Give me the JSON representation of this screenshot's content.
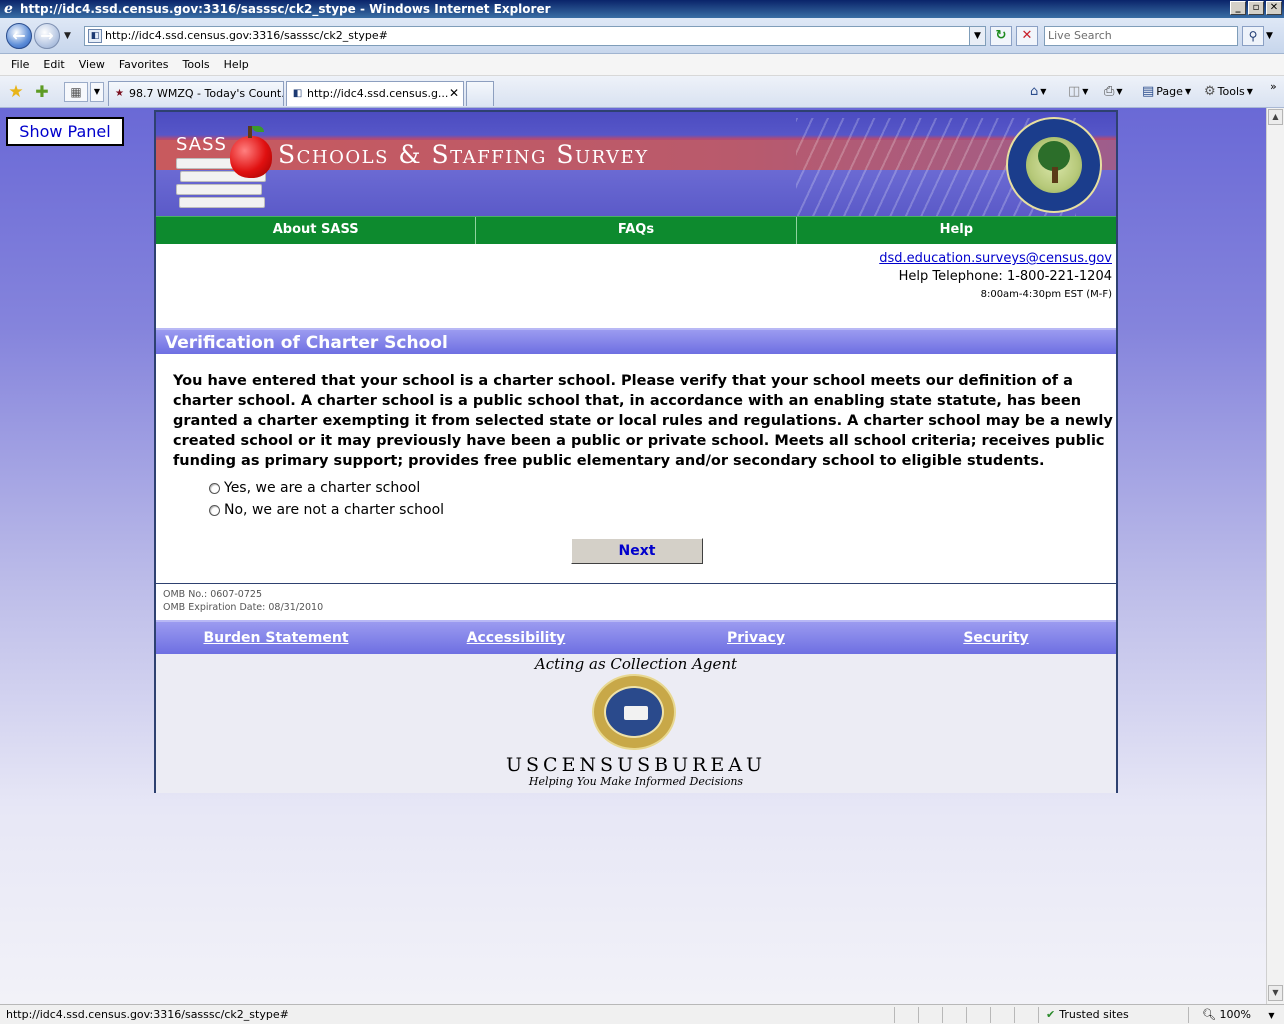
{
  "window": {
    "title": "http://idc4.ssd.census.gov:3316/sasssc/ck2_stype - Windows Internet Explorer",
    "buttons": [
      "_",
      "▫",
      "✕"
    ]
  },
  "address": {
    "url": "http://idc4.ssd.census.gov:3316/sasssc/ck2_stype#",
    "search_placeholder": "Live Search"
  },
  "menu": [
    "File",
    "Edit",
    "View",
    "Favorites",
    "Tools",
    "Help"
  ],
  "tabs": [
    {
      "label": "98.7 WMZQ - Today's Count..."
    },
    {
      "label": "http://idc4.ssd.census.g..."
    }
  ],
  "commands": {
    "page": "Page",
    "tools": "Tools"
  },
  "page": {
    "show_panel": "Show Panel",
    "banner": {
      "sass": "SASS",
      "title": "Schools & Staffing Survey"
    },
    "nav": [
      "About SASS",
      "FAQs",
      "Help"
    ],
    "contact": {
      "email": "dsd.education.surveys@census.gov",
      "telephone": "Help Telephone: 1-800-221-1204",
      "hours": "8:00am-4:30pm EST (M-F)"
    },
    "section_title": "Verification of Charter School",
    "question": "You have entered that your school is a charter school. Please verify that your school meets our definition of a charter school. A charter school is a public school that, in accordance with an enabling state statute, has been granted a charter exempting it from selected state or local rules and regulations. A charter school may be a newly created school or it may previously have been a public or private school. Meets all school criteria; receives public funding as primary support; provides free public elementary and/or secondary school to eligible students.",
    "options": [
      "Yes, we are a charter school",
      "No, we are not a charter school"
    ],
    "next_label": "Next",
    "omb_no": "OMB No.: 0607-0725",
    "omb_expiration": "OMB Expiration Date: 08/31/2010",
    "footer_links": [
      "Burden Statement",
      "Accessibility",
      "Privacy",
      "Security"
    ],
    "acting": "Acting as Collection Agent",
    "census_name": "USCENSUSBUREAU",
    "census_tagline": "Helping You Make Informed Decisions"
  },
  "status": {
    "url": "http://idc4.ssd.census.gov:3316/sasssc/ck2_stype#",
    "zone": "Trusted sites",
    "zoom": "100%"
  },
  "colors": {
    "nav_green": "#0d8a2e",
    "section_purple": "#7c7ce6",
    "link_blue": "#0000cc"
  }
}
